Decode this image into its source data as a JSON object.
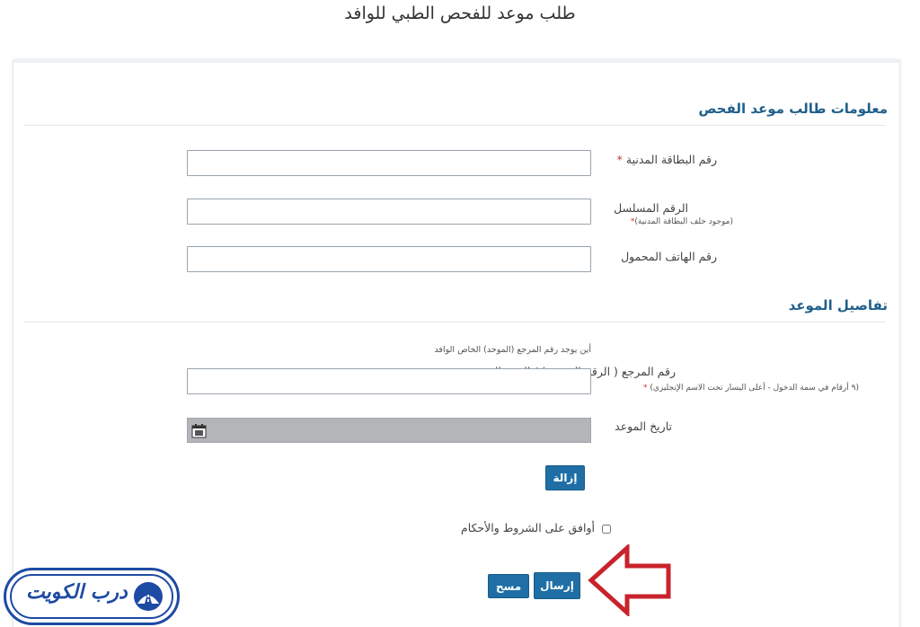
{
  "page": {
    "title": "طلب موعد للفحص الطبي للوافد"
  },
  "applicant_section": {
    "title": "معلومات طالب موعد الفحص",
    "civil_id_label": "رقم البطاقة المدنية",
    "required_mark": "*",
    "serial_label": "الرقم المسلسل",
    "serial_hint": "(موجود خلف البطاقة المدنية)",
    "mobile_label": "رقم الهاتف المحمول"
  },
  "appointment_section": {
    "title": "تفاصيل الموعد",
    "ref_help_link": "أين يوجد رقم المرجع (الموحد) الخاص الوافد",
    "ref_label": "رقم المرجع ( الرقم الموحد ) / الرقم المدني",
    "ref_hint": "(٩ أرقام في سمة الدخول - أعلى اليسار تحت الاسم الإنجليزي)",
    "date_label": "تاريخ الموعد",
    "clear_button": "إزالة"
  },
  "terms": {
    "label": "أوافق على الشروط والأحكام"
  },
  "actions": {
    "submit": "إرسال",
    "reset": "مسح"
  },
  "logo": {
    "text": "درب الكويت"
  },
  "colors": {
    "accent": "#1f6fa6",
    "heading": "#1f5f8b",
    "arrow": "#c8232c",
    "logo": "#1d4aa3"
  }
}
